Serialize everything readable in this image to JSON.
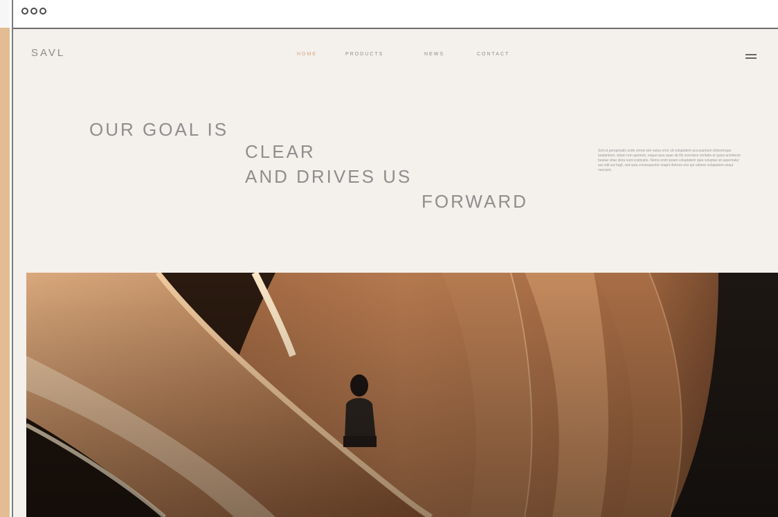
{
  "window": {
    "controls": [
      "close-dot",
      "minimize-dot",
      "maximize-dot"
    ]
  },
  "site": {
    "logo": "SAVL",
    "nav": [
      "HOME",
      "PRODUCTS",
      "NEWS",
      "CONTACT"
    ],
    "menu_icon": "hamburger-icon"
  },
  "hero": {
    "headline": [
      "OUR GOAL IS",
      "CLEAR",
      "AND DRIVES US",
      "FORWARD"
    ],
    "paragraph": "Sed ut perspiciatis unde omnis iste natus error sit voluptatem accusantium doloremque laudantium, totam rem aperiam, eaque ipsa quae ab illo inventore veritatis et quasi architecto beatae vitae dicta sunt explicabo. Nemo enim ipsam voluptatem quia voluptas sit aspernatur aut odit aut fugit, sed quia consequuntur magni dolores eos qui ratione voluptatem sequi nesciunt."
  },
  "colors": {
    "background": "#f4f0ec",
    "text": "#8e8e8e",
    "accent": "#d4a47c",
    "wood_dark": "#3a2418",
    "wood_light": "#b5794f"
  }
}
